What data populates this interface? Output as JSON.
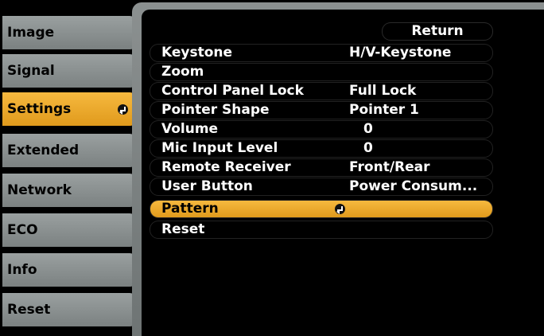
{
  "sidebar": {
    "items": [
      {
        "label": "Image"
      },
      {
        "label": "Signal"
      },
      {
        "label": "Settings",
        "active": true
      },
      {
        "label": "Extended"
      },
      {
        "label": "Network"
      },
      {
        "label": "ECO"
      },
      {
        "label": "Info"
      },
      {
        "label": "Reset"
      }
    ]
  },
  "menu": {
    "return_label": "Return",
    "rows": [
      {
        "label": "Keystone",
        "value": "H/V-Keystone"
      },
      {
        "label": "Zoom",
        "value": ""
      },
      {
        "label": "Control Panel Lock",
        "value": "Full Lock"
      },
      {
        "label": "Pointer Shape",
        "value": "Pointer 1"
      },
      {
        "label": "Volume",
        "value": "0"
      },
      {
        "label": "Mic Input Level",
        "value": "0"
      },
      {
        "label": "Remote Receiver",
        "value": "Front/Rear"
      },
      {
        "label": "User Button",
        "value": "Power Consum..."
      },
      {
        "label": "Pattern",
        "value": ""
      },
      {
        "label": "Reset",
        "value": ""
      }
    ]
  },
  "colors": {
    "highlight": "#f0a830",
    "tab": "#8a9090",
    "background": "#000000"
  },
  "icons": {
    "enter": "enter-icon"
  }
}
